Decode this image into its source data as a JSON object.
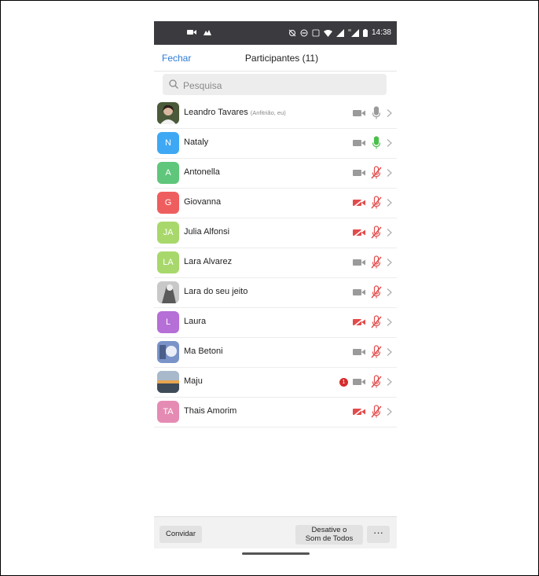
{
  "status_bar": {
    "time": "14:38"
  },
  "header": {
    "close_label": "Fechar",
    "title": "Participantes (11)"
  },
  "search": {
    "placeholder": "Pesquisa"
  },
  "participants": [
    {
      "name": "Leandro Tavares",
      "role": "(Anfitrião, eu)",
      "initials": "",
      "avatar_type": "photo",
      "avatar_color": "#4a5a3a",
      "video": "on",
      "mic": "on",
      "notifications": ""
    },
    {
      "name": "Nataly",
      "role": "",
      "initials": "N",
      "avatar_type": "initials",
      "avatar_color": "#3fa8f4",
      "video": "on",
      "mic": "speaking",
      "notifications": ""
    },
    {
      "name": "Antonella",
      "role": "",
      "initials": "A",
      "avatar_type": "initials",
      "avatar_color": "#5fc67b",
      "video": "on",
      "mic": "muted",
      "notifications": ""
    },
    {
      "name": "Giovanna",
      "role": "",
      "initials": "G",
      "avatar_type": "initials",
      "avatar_color": "#ef5e5e",
      "video": "off",
      "mic": "muted",
      "notifications": ""
    },
    {
      "name": "Julia Alfonsi",
      "role": "",
      "initials": "JA",
      "avatar_type": "initials",
      "avatar_color": "#a8d86b",
      "video": "off",
      "mic": "muted",
      "notifications": ""
    },
    {
      "name": "Lara Alvarez",
      "role": "",
      "initials": "LA",
      "avatar_type": "initials",
      "avatar_color": "#a8d86b",
      "video": "on",
      "mic": "muted",
      "notifications": ""
    },
    {
      "name": "Lara do seu jeito",
      "role": "",
      "initials": "",
      "avatar_type": "photo",
      "avatar_color": "#c8c8c8",
      "video": "on",
      "mic": "muted",
      "notifications": ""
    },
    {
      "name": "Laura",
      "role": "",
      "initials": "L",
      "avatar_type": "initials",
      "avatar_color": "#b56fd6",
      "video": "off",
      "mic": "muted",
      "notifications": ""
    },
    {
      "name": "Ma Betoni",
      "role": "",
      "initials": "",
      "avatar_type": "photo",
      "avatar_color": "#7a93c8",
      "video": "on",
      "mic": "muted",
      "notifications": ""
    },
    {
      "name": "Maju",
      "role": "",
      "initials": "",
      "avatar_type": "photo",
      "avatar_color": "#6b7f95",
      "video": "on",
      "mic": "muted",
      "notifications": "1"
    },
    {
      "name": "Thais Amorim",
      "role": "",
      "initials": "TA",
      "avatar_type": "initials",
      "avatar_color": "#e58bb3",
      "video": "off",
      "mic": "muted",
      "notifications": ""
    }
  ],
  "footer": {
    "invite_label": "Convidar",
    "mute_all_line1": "Desative o",
    "mute_all_line2": "Som de Todos",
    "more_label": "···"
  },
  "colors": {
    "status_bar": "#3a3a3f",
    "link": "#2d7bd6",
    "muted_red": "#e24b4b",
    "speaking_green": "#4bc04b",
    "icon_gray": "#9a9a9a"
  }
}
